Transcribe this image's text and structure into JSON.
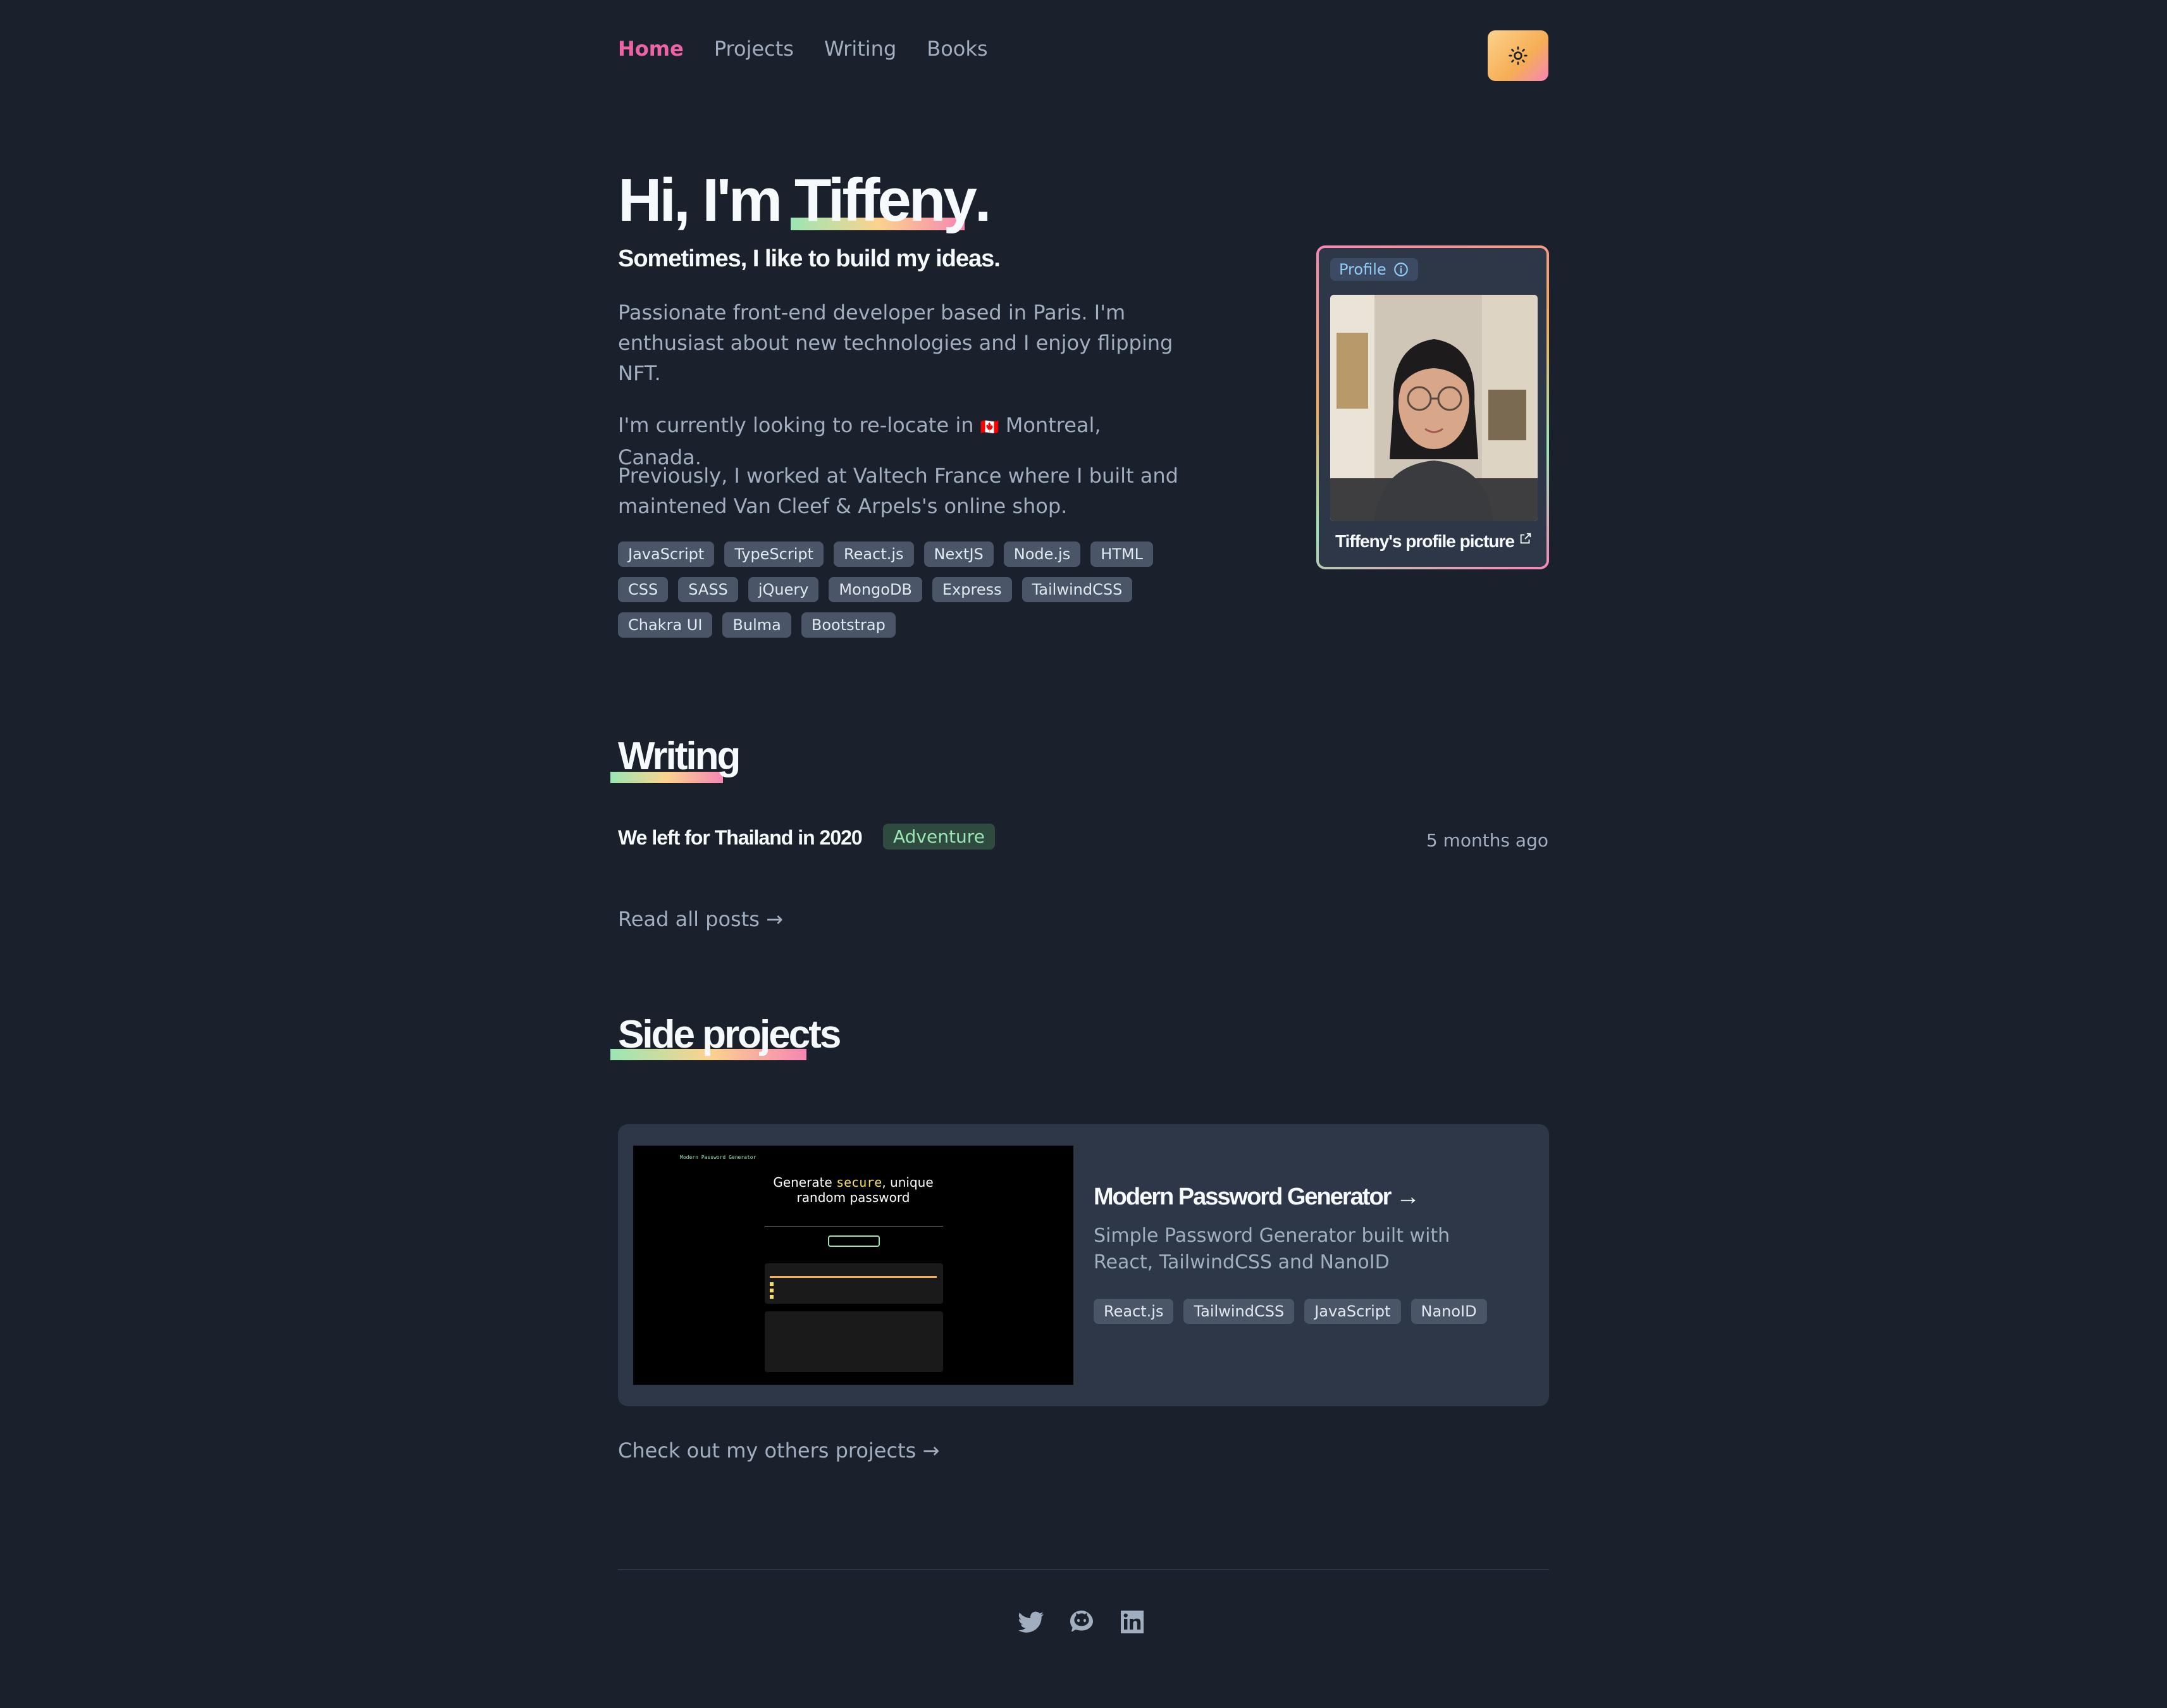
{
  "nav": {
    "items": [
      {
        "label": "Home",
        "active": true
      },
      {
        "label": "Projects",
        "active": false
      },
      {
        "label": "Writing",
        "active": false
      },
      {
        "label": "Books",
        "active": false
      }
    ],
    "theme_toggle_icon": "sun-icon"
  },
  "hero": {
    "greeting": "Hi, I'm ",
    "name": "Tiffeny",
    "greeting_end": ".",
    "subtitle": "Sometimes, I like to build my ideas.",
    "intro": "Passionate front-end developer based in Paris. I'm enthusiast about new technologies and I enjoy flipping NFT.",
    "relocate_prefix": "I'm currently looking to re-locate in",
    "relocate_flag": "🇨🇦",
    "relocate_suffix": "Montreal, Canada.",
    "previously": "Previously, I worked at Valtech France where I built and maintened Van Cleef & Arpels's online shop.",
    "skills": [
      "JavaScript",
      "TypeScript",
      "React.js",
      "NextJS",
      "Node.js",
      "HTML",
      "CSS",
      "SASS",
      "jQuery",
      "MongoDB",
      "Express",
      "TailwindCSS",
      "Chakra UI",
      "Bulma",
      "Bootstrap"
    ]
  },
  "profile": {
    "badge": "Profile",
    "caption": "Tiffeny's profile picture"
  },
  "writing": {
    "title": "Writing",
    "posts": [
      {
        "title": "We left for Thailand in 2020",
        "tag": "Adventure",
        "date": "5 months ago"
      }
    ],
    "read_all": "Read all posts →"
  },
  "projects": {
    "title": "Side projects",
    "items": [
      {
        "title": "Modern Password Generator →",
        "description": "Simple Password Generator built with React, TailwindCSS and NanoID",
        "tags": [
          "React.js",
          "TailwindCSS",
          "JavaScript",
          "NanoID"
        ],
        "screenshot": {
          "header": "Modern Password Generator",
          "headline_a": "Generate ",
          "headline_accent": "secure",
          "headline_b": ", unique",
          "headline_c": "random password"
        }
      }
    ],
    "more": "Check out my others projects →"
  },
  "footer": {
    "socials": [
      "twitter-icon",
      "github-icon",
      "linkedin-icon"
    ]
  },
  "colors": {
    "background": "#1a202c",
    "accent_pink": "#ed64a6",
    "heading": "#f7fafc",
    "tag_bg": "#4a5568"
  }
}
